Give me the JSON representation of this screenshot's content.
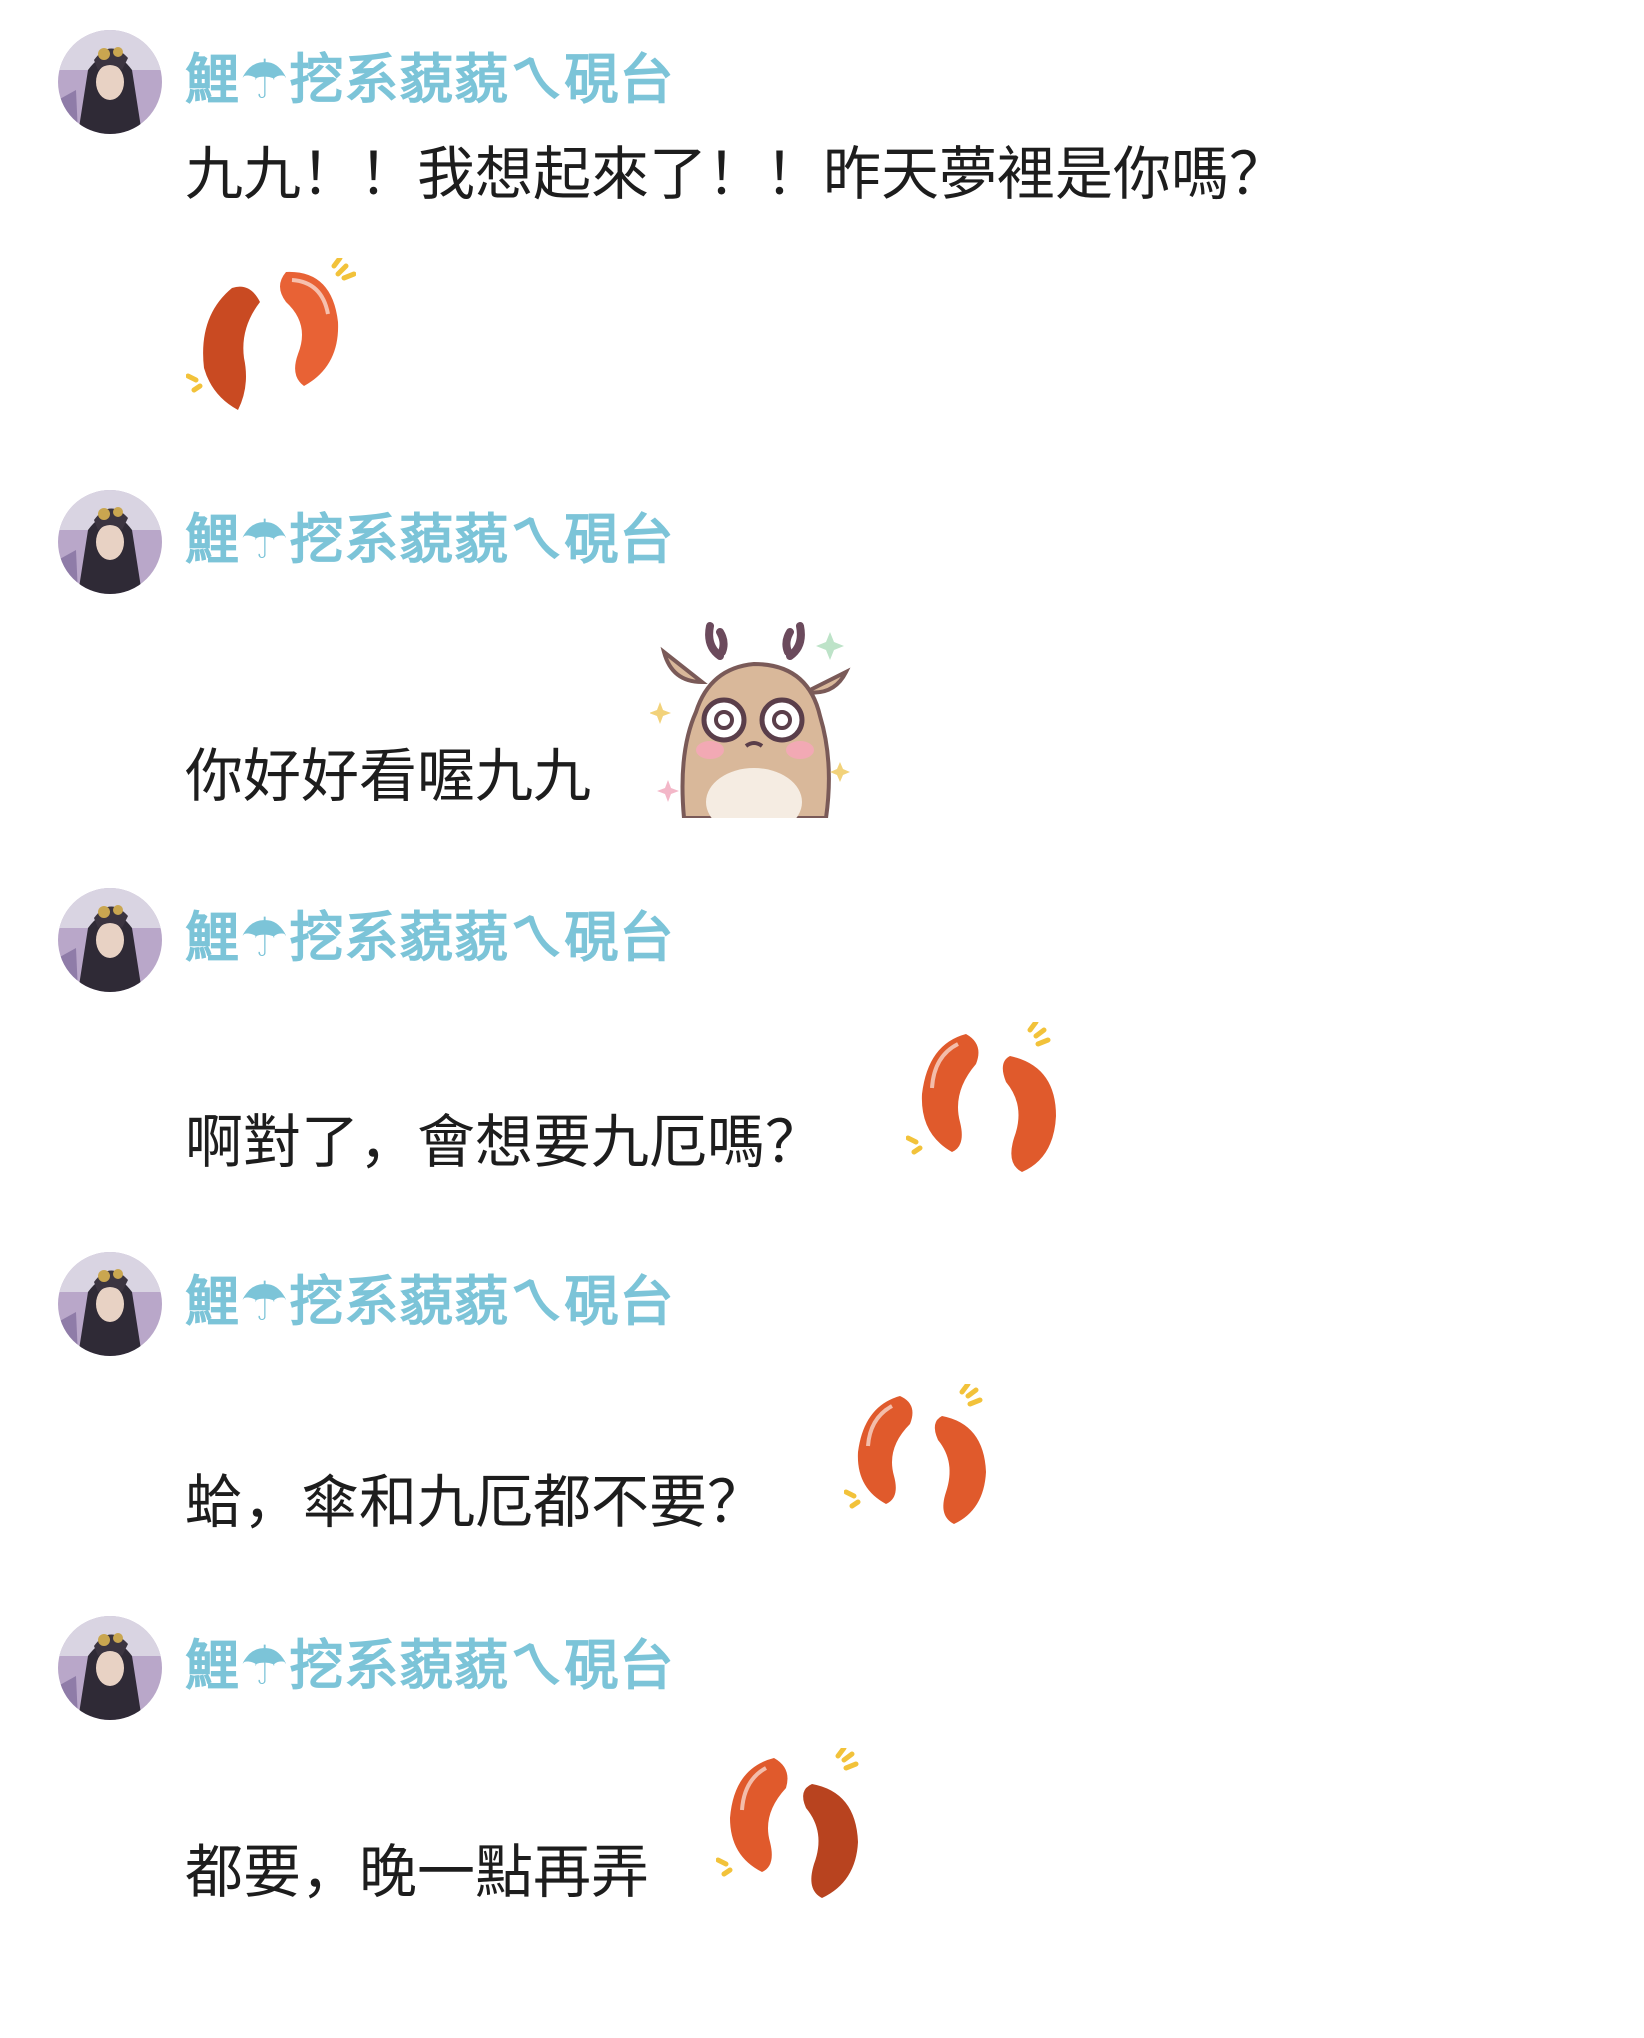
{
  "chat": {
    "colors": {
      "username": "#7cc4d8",
      "message_text": "#1d1d1d",
      "background": "#ffffff",
      "bean_fill": "#e0582a",
      "sparkle": "#f2c23a"
    },
    "messages": [
      {
        "username": "鯉☂挖系藐藐ㄟ硯台",
        "text": "九九！！我想起來了！！昨天夢裡是你嗎？",
        "sticker": "red-bean-pair-icon"
      },
      {
        "username": "鯉☂挖系藐藐ㄟ硯台",
        "text": "你好好看喔九九",
        "sticker": "deer-sticker-icon"
      },
      {
        "username": "鯉☂挖系藐藐ㄟ硯台",
        "text": "啊對了，會想要九厄嗎？",
        "sticker": "red-bean-pair-icon"
      },
      {
        "username": "鯉☂挖系藐藐ㄟ硯台",
        "text": "蛤，傘和九厄都不要？",
        "sticker": "red-bean-pair-icon"
      },
      {
        "username": "鯉☂挖系藐藐ㄟ硯台",
        "text": "都要，晚一點再弄",
        "sticker": "red-bean-pair-icon"
      }
    ]
  }
}
